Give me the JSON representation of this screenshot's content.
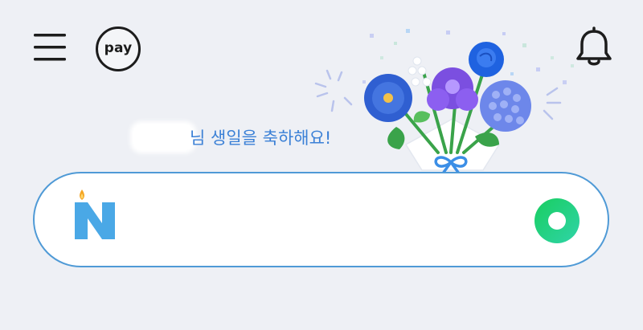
{
  "header": {
    "menu_icon": "hamburger-menu-icon",
    "pay_label": "pay",
    "bell_icon": "notification-bell-icon"
  },
  "banner": {
    "greeting_text": "님 생일을 축하해요!",
    "illustration": "flower-bouquet-illustration"
  },
  "search": {
    "logo_icon": "naver-birthday-candle-logo",
    "action_icon": "green-voice-search-icon",
    "input_value": ""
  },
  "colors": {
    "background": "#eef0f5",
    "accent_blue": "#3b80d6",
    "search_border": "#4f9ad6",
    "green_button": "#19ce60"
  }
}
